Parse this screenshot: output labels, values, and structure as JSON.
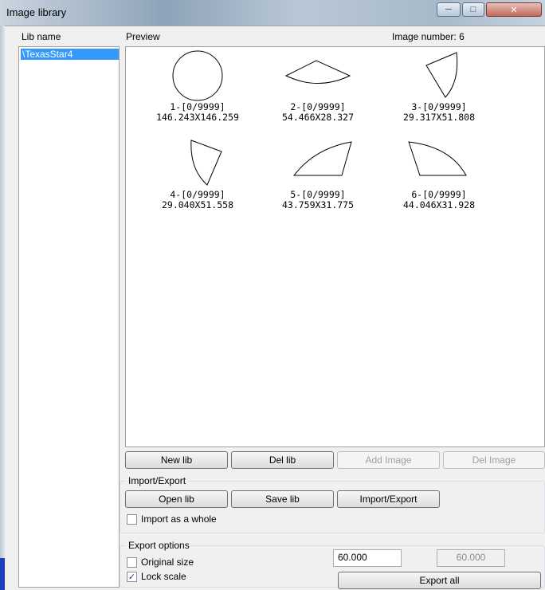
{
  "window": {
    "title": "Image library",
    "controls": {
      "minimize": "─",
      "maximize": "□",
      "close": "✕"
    }
  },
  "labels": {
    "lib_name": "Lib name",
    "preview": "Preview",
    "image_number_label": "Image number:",
    "image_number_value": "6"
  },
  "libraries": [
    {
      "name": "\\TexasStar4",
      "selected": true
    }
  ],
  "images": [
    {
      "name": "1-[0/9999]",
      "size": "146.243X146.259",
      "shape": "circle"
    },
    {
      "name": "2-[0/9999]",
      "size": "54.466X28.327",
      "shape": "sector-down"
    },
    {
      "name": "3-[0/9999]",
      "size": "29.317X51.808",
      "shape": "sector-right"
    },
    {
      "name": "4-[0/9999]",
      "size": "29.040X51.558",
      "shape": "sector-left"
    },
    {
      "name": "5-[0/9999]",
      "size": "43.759X31.775",
      "shape": "sector-up-right"
    },
    {
      "name": "6-[0/9999]",
      "size": "44.046X31.928",
      "shape": "sector-up-left"
    }
  ],
  "buttons": {
    "new_lib": "New lib",
    "del_lib": "Del lib",
    "add_image": "Add Image",
    "del_image": "Del Image",
    "open_lib": "Open lib",
    "save_lib": "Save lib",
    "import_export": "Import/Export",
    "export_all": "Export all"
  },
  "import_export_group": {
    "title": "Import/Export",
    "import_whole_label": "Import as a whole",
    "import_whole_checked": false
  },
  "export_options": {
    "title": "Export options",
    "original_size_label": "Original size",
    "original_size_checked": false,
    "lock_scale_label": "Lock scale",
    "lock_scale_checked": true,
    "width_value": "60.000",
    "height_value": "60.000"
  }
}
